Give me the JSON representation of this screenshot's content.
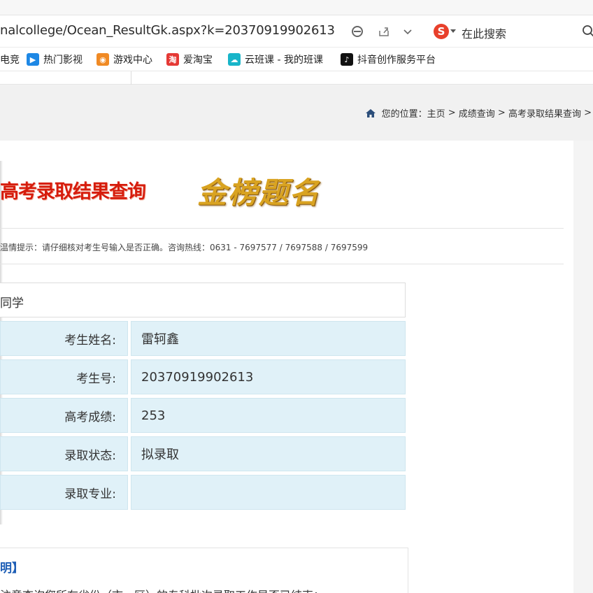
{
  "browser": {
    "url": "nalcollege/Ocean_ResultGk.aspx?k=20370919902613",
    "search_label": "在此搜索"
  },
  "bookmarks": [
    {
      "label": "电竞",
      "icon": "game-icon",
      "color": "#e44"
    },
    {
      "label": "热门影视",
      "icon": "play-icon",
      "color": "#1e88e5"
    },
    {
      "label": "游戏中心",
      "icon": "gamepad-icon",
      "color": "#f08a24"
    },
    {
      "label": "爱淘宝",
      "icon": "taobao-icon",
      "color": "#e53935"
    },
    {
      "label": "云班课 - 我的班课",
      "icon": "cloud-icon",
      "color": "#19b5c9"
    },
    {
      "label": "抖音创作服务平台",
      "icon": "douyin-icon",
      "color": "#111111"
    }
  ],
  "breadcrumb": {
    "prefix": "您的位置：",
    "home": "主页",
    "sep": " > ",
    "level1": "成绩查询",
    "level2": "高考录取结果查询",
    "tail": " >"
  },
  "page": {
    "title": "高考录取结果查询",
    "banner": "金榜题名",
    "notice": "温情提示：请仔细核对考生号输入是否正确。咨询热线：0631 - 7697577 / 7697588 / 7697599",
    "table_heading": "同学"
  },
  "result": [
    {
      "label": "考生姓名:",
      "value": "雷轲鑫"
    },
    {
      "label": "考生号:",
      "value": "20370919902613"
    },
    {
      "label": "高考成绩:",
      "value": "253"
    },
    {
      "label": "录取状态:",
      "value": "拟录取"
    },
    {
      "label": "录取专业:",
      "value": ""
    }
  ],
  "note": {
    "title": "明】",
    "text": "注意查询您所在省份（市、区）的专科批次录取工作是否已结束；"
  },
  "colors": {
    "title_red": "#d61c0c",
    "gold": "#d9a321",
    "cell_bg": "#e0f1f8",
    "link_blue": "#1f5fb6"
  }
}
